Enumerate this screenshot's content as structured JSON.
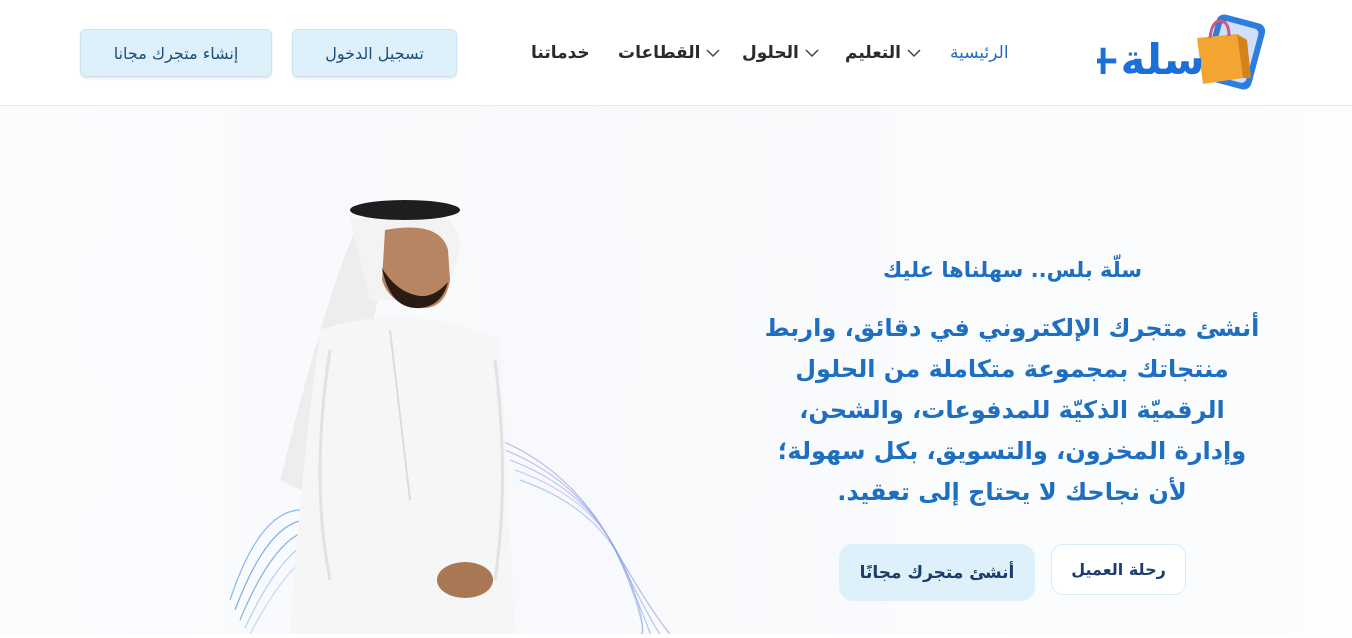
{
  "header": {
    "logo_text": "سلة+",
    "nav": [
      {
        "label": "الرئيسية",
        "active": true,
        "has_dropdown": false
      },
      {
        "label": "التعليم",
        "active": false,
        "has_dropdown": true
      },
      {
        "label": "الحلول",
        "active": false,
        "has_dropdown": true
      },
      {
        "label": "القطاعات",
        "active": false,
        "has_dropdown": true
      },
      {
        "label": "خدماتنا",
        "active": false,
        "has_dropdown": false
      }
    ],
    "login_label": "تسجيل الدخول",
    "signup_label": "إنشاء متجرك مجانا"
  },
  "hero": {
    "tagline": "سلّة بلس.. سهلناها عليك",
    "description": "أنشئ متجرك الإلكتروني في دقائق، واربط منتجاتك بمجموعة متكاملة من الحلول الرقميّة الذكيّة للمدفوعات، والشحن، وإدارة المخزون، والتسويق، بكل سهولة؛ لأن نجاحك لا يحتاج إلى تعقيد.",
    "cta_primary": "أنشئ متجرك مجانًا",
    "cta_secondary": "رحلة العميل"
  },
  "colors": {
    "accent": "#1f6fc0",
    "button_bg": "#def1fb",
    "logo_blue": "#1c6fd8",
    "bag_orange": "#f2a531"
  },
  "icons": [
    "chevron-down-icon",
    "shopping-bag-icon",
    "phone-icon"
  ]
}
